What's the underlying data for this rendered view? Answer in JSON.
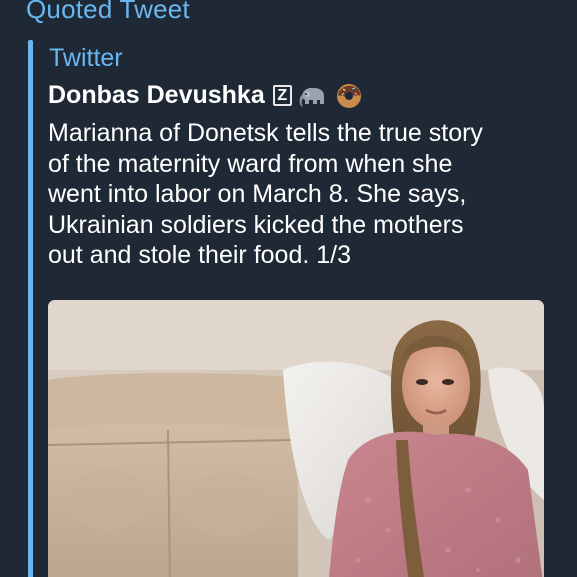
{
  "quote": {
    "header": "Quoted Tweet",
    "source": "Twitter",
    "author": "Donbas Devushka",
    "author_badge": "Z",
    "author_emoji": [
      "elephant-icon",
      "donut-icon"
    ],
    "text_lines": [
      "Marianna of Donetsk tells the true story",
      "of the maternity ward from when she",
      "went into labor on March 8. She says,",
      "Ukrainian soldiers kicked the mothers",
      "out and stole their food. 1/3"
    ],
    "media": {
      "kind": "video-thumbnail"
    }
  },
  "colors": {
    "background": "#1f2936",
    "accent": "#6ab7f0",
    "text": "#ffffff"
  }
}
